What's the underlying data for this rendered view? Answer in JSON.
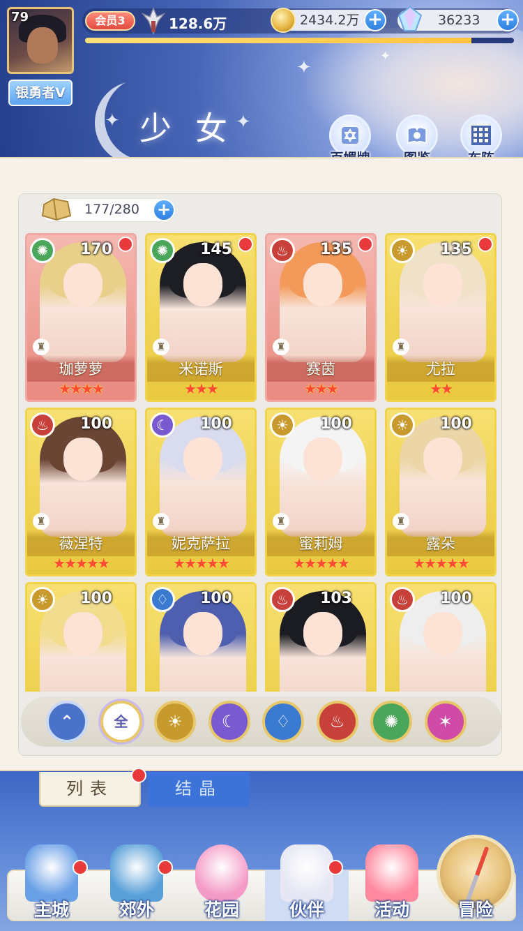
{
  "header": {
    "level": "79",
    "player_name": "银勇者V",
    "vip_label": "会员3",
    "power": "128.6万",
    "exp_progress": 0.9,
    "gold": "2434.2万",
    "gems": "36233",
    "plus": "+",
    "title": "少女",
    "buttons": [
      {
        "label": "百媚牌",
        "icon": "card-deck-icon"
      },
      {
        "label": "图鉴",
        "icon": "book-icon"
      },
      {
        "label": "布阵",
        "icon": "formation-grid-icon"
      }
    ]
  },
  "capacity": "177/280",
  "colors": {
    "wind": "#4aa65a",
    "fire": "#c8403a",
    "sun": "#c89a2e",
    "moon": "#7a5ad0",
    "water": "#3a7ad0",
    "chaos": "#d04aa8",
    "gold_card": "#e9c93e",
    "red_card": "#e98a80"
  },
  "cards": [
    {
      "name": "珈萝萝",
      "level": "170",
      "element": "wind",
      "stars": 4,
      "theme": "red",
      "hair": "#e9d08a",
      "dot": true
    },
    {
      "name": "米诺斯",
      "level": "145",
      "element": "wind",
      "stars": 3,
      "theme": "gold",
      "hair": "#1d1d24",
      "dot": true
    },
    {
      "name": "赛茵",
      "level": "135",
      "element": "fire",
      "stars": 3,
      "theme": "red",
      "hair": "#f39a5a",
      "dot": true
    },
    {
      "name": "尤拉",
      "level": "135",
      "element": "sun",
      "stars": 2,
      "theme": "gold",
      "hair": "#efe2c8",
      "dot": true
    },
    {
      "name": "薇涅特",
      "level": "100",
      "element": "fire",
      "stars": 5,
      "theme": "gold",
      "hair": "#6a4534",
      "dot": false
    },
    {
      "name": "妮克萨拉",
      "level": "100",
      "element": "moon",
      "stars": 5,
      "theme": "gold",
      "hair": "#d9dcef",
      "dot": false
    },
    {
      "name": "蜜莉姆",
      "level": "100",
      "element": "sun",
      "stars": 5,
      "theme": "gold",
      "hair": "#f4f4f4",
      "dot": false
    },
    {
      "name": "露朵",
      "level": "100",
      "element": "sun",
      "stars": 5,
      "theme": "gold",
      "hair": "#ecd6a8",
      "dot": false
    },
    {
      "name": "",
      "level": "100",
      "element": "sun",
      "stars": 0,
      "theme": "gold",
      "hair": "#f2dc8e",
      "dot": false
    },
    {
      "name": "",
      "level": "100",
      "element": "water",
      "stars": 0,
      "theme": "gold",
      "hair": "#4e5fb0",
      "dot": false
    },
    {
      "name": "",
      "level": "103",
      "element": "fire",
      "stars": 0,
      "theme": "gold",
      "hair": "#1b1b22",
      "dot": false
    },
    {
      "name": "",
      "level": "100",
      "element": "fire",
      "stars": 0,
      "theme": "gold",
      "hair": "#eeeeee",
      "dot": false
    }
  ],
  "filters": [
    {
      "id": "rank",
      "label": ""
    },
    {
      "id": "all",
      "label": "全"
    },
    {
      "id": "sun",
      "label": ""
    },
    {
      "id": "moon",
      "label": ""
    },
    {
      "id": "water",
      "label": ""
    },
    {
      "id": "fire",
      "label": ""
    },
    {
      "id": "wind",
      "label": ""
    },
    {
      "id": "chaos",
      "label": ""
    }
  ],
  "tabs": {
    "list": "列表",
    "crystal": "结晶"
  },
  "nav": [
    {
      "label": "主城",
      "dot": true
    },
    {
      "label": "郊外",
      "dot": true
    },
    {
      "label": "花园",
      "dot": false
    },
    {
      "label": "伙伴",
      "dot": true
    },
    {
      "label": "活动",
      "dot": false
    },
    {
      "label": "冒险",
      "dot": false
    }
  ]
}
